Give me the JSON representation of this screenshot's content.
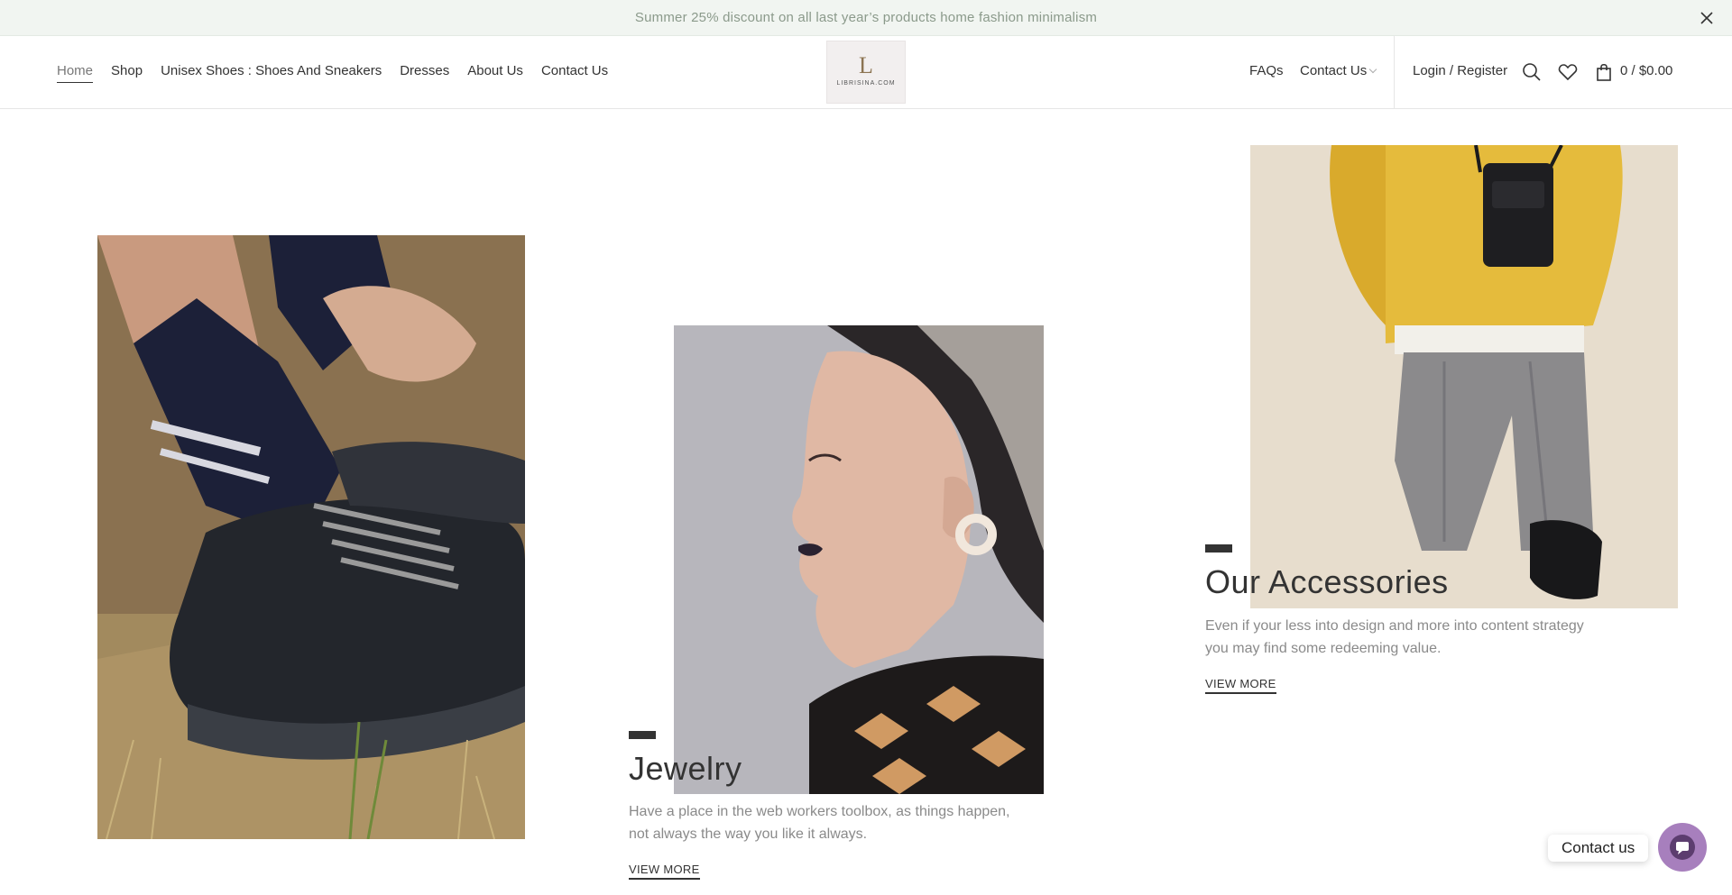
{
  "announcement": {
    "text": "Summer 25% discount on all last year’s products home fashion minimalism",
    "close_icon": "close-icon"
  },
  "header": {
    "nav_left": [
      {
        "label": "Home",
        "active": true
      },
      {
        "label": "Shop"
      },
      {
        "label": "Unisex Shoes : Shoes And Sneakers"
      },
      {
        "label": "Dresses"
      },
      {
        "label": "About Us"
      },
      {
        "label": "Contact Us"
      }
    ],
    "logo": {
      "mark": "L",
      "text": "LIBRISINA.COM"
    },
    "nav_right": {
      "faqs": "FAQs",
      "contact": "Contact Us",
      "login": "Login / Register",
      "cart": "0 / $0.00"
    },
    "icons": [
      "search-icon",
      "heart-icon",
      "shopping-bag-icon"
    ]
  },
  "blocks": {
    "jewelry": {
      "title": "Jewelry",
      "description": "Have a place in the web workers toolbox, as things happen, not always the way you like it always.",
      "link": "VIEW MORE"
    },
    "accessories": {
      "title": "Our Accessories",
      "description": "Even if your less into design and more into content strategy you may find some redeeming value.",
      "link": "VIEW MORE"
    }
  },
  "chat": {
    "label": "Contact us"
  },
  "colors": {
    "announcement_bg": "#f1f5f1",
    "text_dark": "#333333",
    "text_muted": "#8a8a8a",
    "chat_bubble": "#a77fbd"
  }
}
